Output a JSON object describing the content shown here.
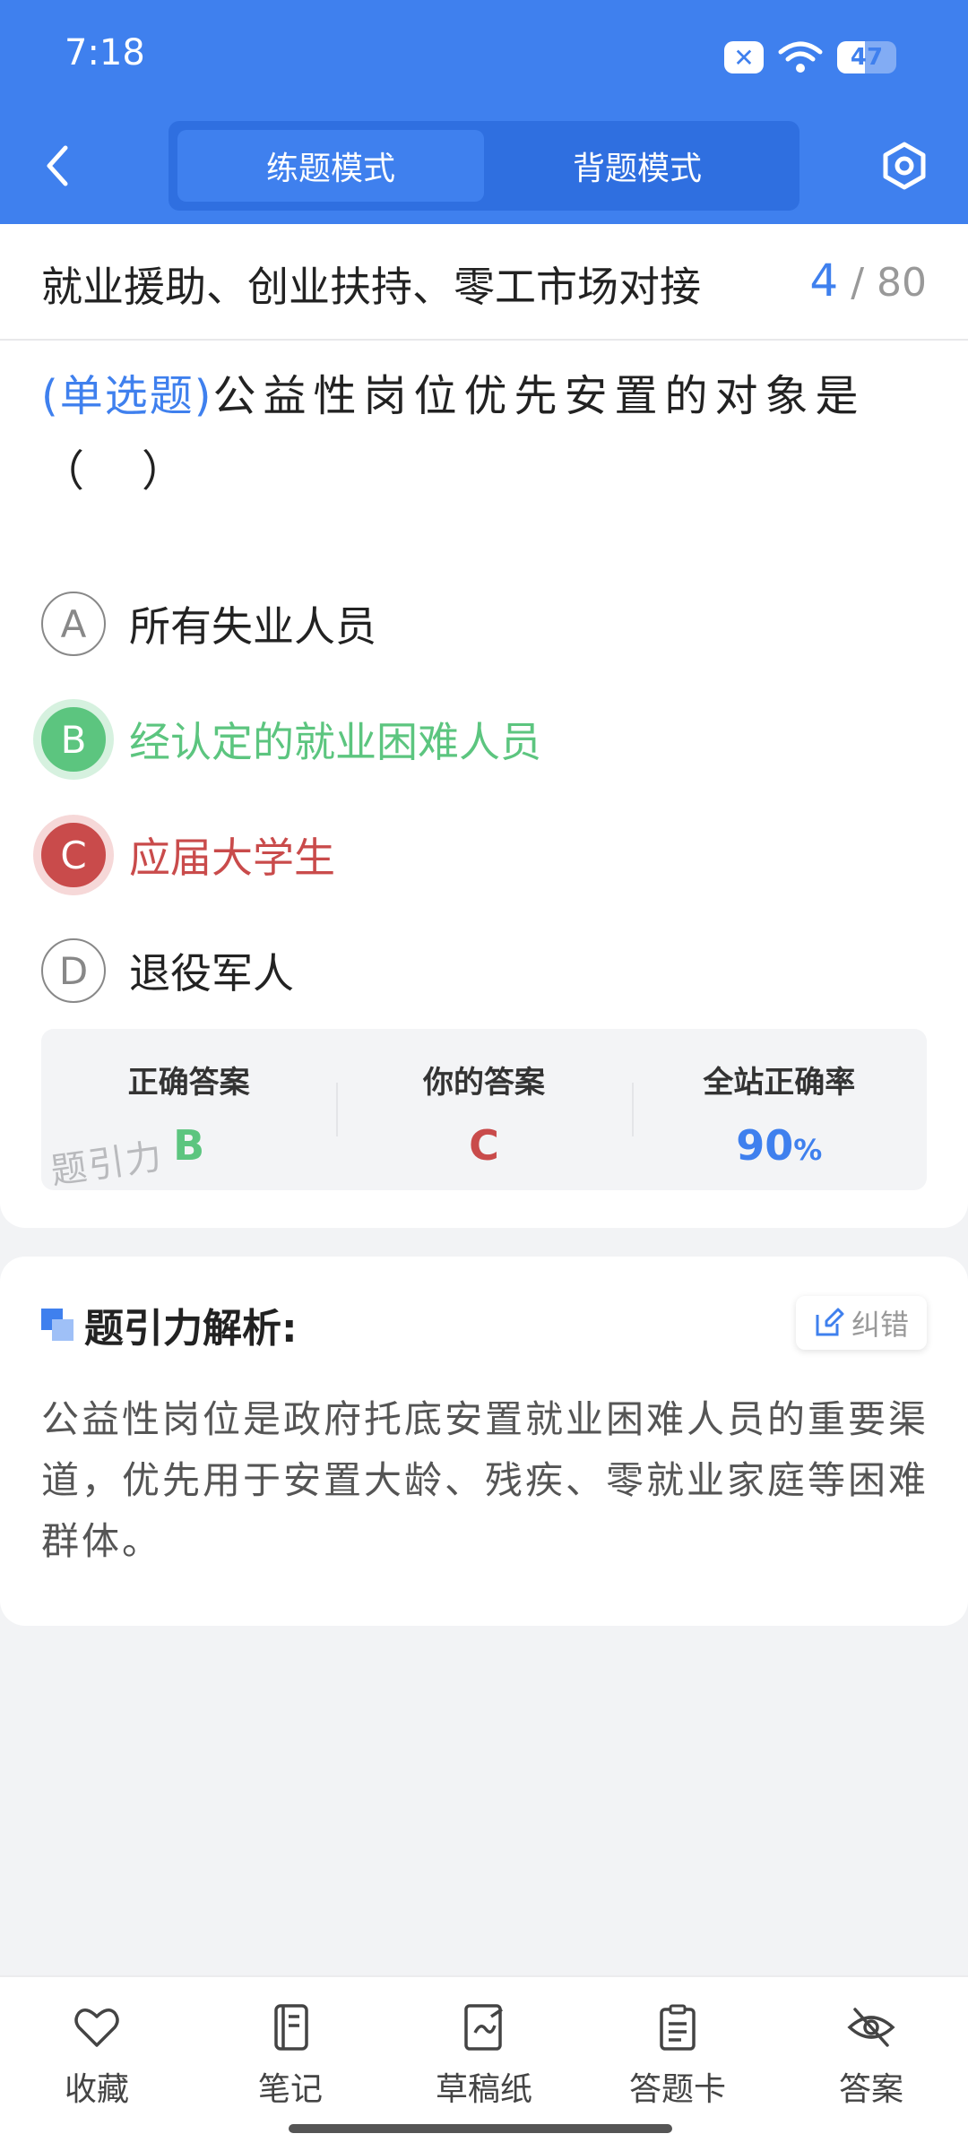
{
  "status_bar": {
    "time": "7:18",
    "battery": "47",
    "battery_level_percent": 47
  },
  "header": {
    "modes": [
      {
        "label": "练题模式",
        "active": true
      },
      {
        "label": "背题模式",
        "active": false
      }
    ]
  },
  "chapter": {
    "title": "就业援助、创业扶持、零工市场对接",
    "current": "4",
    "total": "/ 80"
  },
  "question": {
    "type": "(单选题)",
    "text": "公益性岗位优先安置的对象是（　）",
    "options": [
      {
        "letter": "A",
        "text": "所有失业人员",
        "state": "normal"
      },
      {
        "letter": "B",
        "text": "经认定的就业困难人员",
        "state": "correct"
      },
      {
        "letter": "C",
        "text": "应届大学生",
        "state": "wrong"
      },
      {
        "letter": "D",
        "text": "退役军人",
        "state": "normal"
      }
    ]
  },
  "result": {
    "correct_label": "正确答案",
    "correct_value": "B",
    "yours_label": "你的答案",
    "yours_value": "C",
    "rate_label": "全站正确率",
    "rate_value": "90",
    "rate_unit": "%",
    "watermark": "题引力"
  },
  "analysis": {
    "title": "题引力解析:",
    "report_label": "纠错",
    "text": "公益性岗位是政府托底安置就业困难人员的重要渠道，优先用于安置大龄、残疾、零就业家庭等困难群体。"
  },
  "bottom_tabs": [
    {
      "label": "收藏",
      "icon": "heart-icon"
    },
    {
      "label": "笔记",
      "icon": "notebook-icon"
    },
    {
      "label": "草稿纸",
      "icon": "draft-paper-icon"
    },
    {
      "label": "答题卡",
      "icon": "answer-card-icon"
    },
    {
      "label": "答案",
      "icon": "eye-off-icon"
    }
  ],
  "colors": {
    "primary": "#3f80ee",
    "correct": "#5cc57f",
    "wrong": "#c94b4b"
  }
}
